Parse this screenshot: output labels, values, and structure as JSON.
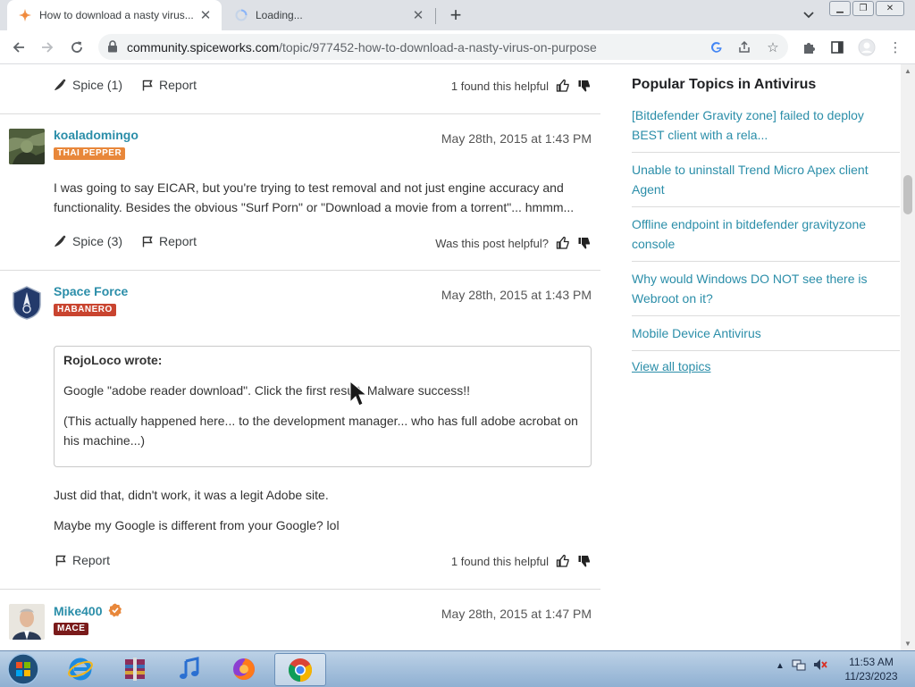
{
  "browser": {
    "tabs": [
      {
        "title": "How to download a nasty virus..."
      },
      {
        "title": "Loading..."
      }
    ],
    "url_host": "community.spiceworks.com",
    "url_path": "/topic/977452-how-to-download-a-nasty-virus-on-purpose"
  },
  "posts": [
    {
      "spice_label": "Spice (1)",
      "report_label": "Report",
      "helpful_text": "1 found this helpful"
    },
    {
      "username": "koaladomingo",
      "badge": "THAI PEPPER",
      "badge_color": "#e8873a",
      "date": "May 28th, 2015 at 1:43 PM",
      "body": "I was going to say EICAR, but you're trying to test removal and not just engine accuracy and functionality.  Besides the obvious \"Surf Porn\" or \"Download a movie from a torrent\"... hmmm...",
      "spice_label": "Spice (3)",
      "report_label": "Report",
      "helpful_text": "Was this post helpful?"
    },
    {
      "username": "Space Force",
      "badge": "HABANERO",
      "badge_color": "#c9442f",
      "date": "May 28th, 2015 at 1:43 PM",
      "quote_author": "RojoLoco wrote:",
      "quote_lines": [
        "Google \"adobe reader download\".  Click the first result. Malware success!!",
        "(This actually happened here... to the development manager... who has full adobe acrobat on his machine...)"
      ],
      "body_lines": [
        "Just did that, didn't work, it was a legit Adobe site.",
        "Maybe my Google is different from your Google? lol"
      ],
      "report_label": "Report",
      "helpful_text": "1 found this helpful"
    },
    {
      "username": "Mike400",
      "badge": "MACE",
      "badge_color": "#7a1b1b",
      "date": "May 28th, 2015 at 1:47 PM"
    }
  ],
  "sidebar": {
    "title": "Popular Topics in Antivirus",
    "topics": [
      "[Bitdefender Gravity zone] failed to deploy BEST client with a rela...",
      "Unable to uninstall Trend Micro Apex client Agent",
      "Offline endpoint in bitdefender gravityzone console",
      "Why would Windows DO NOT see there is Webroot on it?",
      "Mobile Device Antivirus"
    ],
    "view_all": "View all topics"
  },
  "taskbar": {
    "time": "11:53 AM",
    "date": "11/23/2023"
  },
  "colors": {
    "link": "#2b8ea9",
    "tabstrip": "#dee1e6"
  }
}
